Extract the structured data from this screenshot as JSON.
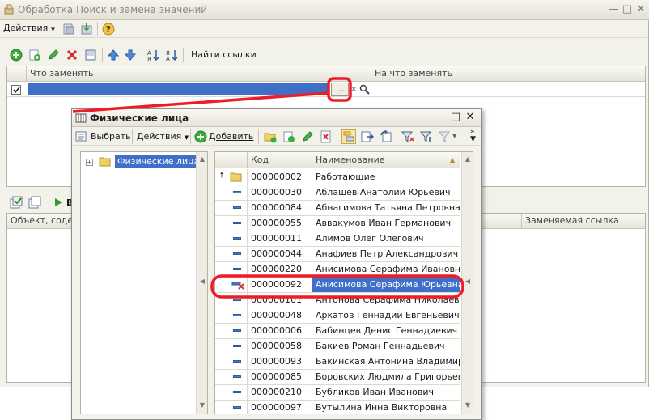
{
  "main": {
    "title": "Обработка  Поиск и замена значений",
    "actions_label": "Действия",
    "find_links_label": "Найти ссылки",
    "grid_top": {
      "col_what": "Что заменять",
      "col_with": "На что заменять",
      "ellipsis": "..."
    },
    "grid_bottom": {
      "col_object": "Объект, содер",
      "col_replaced": "Заменяемая ссылка",
      "run_label": "В"
    }
  },
  "popup": {
    "title": "Физические лица",
    "select_label": "Выбрать",
    "actions_label": "Действия",
    "add_label": "Добавить",
    "tree_root": "Физические лица",
    "col_code": "Код",
    "col_name": "Наименование",
    "rows": [
      {
        "code": "000000002",
        "name": "Работающие",
        "kind": "folder"
      },
      {
        "code": "000000030",
        "name": "Аблашев Анатолий Юрьевич",
        "kind": "item"
      },
      {
        "code": "000000084",
        "name": "Абнагимова Татьяна Петровна",
        "kind": "item"
      },
      {
        "code": "000000055",
        "name": "Аввакумов Иван Германович",
        "kind": "item"
      },
      {
        "code": "000000011",
        "name": "Алимов Олег Олегович",
        "kind": "item"
      },
      {
        "code": "000000044",
        "name": "Анафиев Петр Александрович",
        "kind": "item"
      },
      {
        "code": "000000220",
        "name": "Анисимова Серафима Ивановна",
        "kind": "item"
      },
      {
        "code": "000000092",
        "name": "Анисимова Серафима Юрьевна",
        "kind": "deleted"
      },
      {
        "code": "000000101",
        "name": "Антонова Серафима Николаевна",
        "kind": "item"
      },
      {
        "code": "000000048",
        "name": "Аркатов Геннадий Евгеньевич",
        "kind": "item"
      },
      {
        "code": "000000006",
        "name": "Бабинцев Денис Геннадиевич",
        "kind": "item"
      },
      {
        "code": "000000058",
        "name": "Бакиев Роман Геннадьевич",
        "kind": "item"
      },
      {
        "code": "000000093",
        "name": "Бакинская Антонина Владимиро...",
        "kind": "item"
      },
      {
        "code": "000000085",
        "name": "Боровских Людмила Григорьевна",
        "kind": "item"
      },
      {
        "code": "000000210",
        "name": "Бубликов Иван Иванович",
        "kind": "item"
      },
      {
        "code": "000000097",
        "name": "Бутылина Инна Викторовна",
        "kind": "item"
      }
    ]
  },
  "colors": {
    "highlight": "#ee1c24",
    "selection": "#3f6fc6"
  }
}
